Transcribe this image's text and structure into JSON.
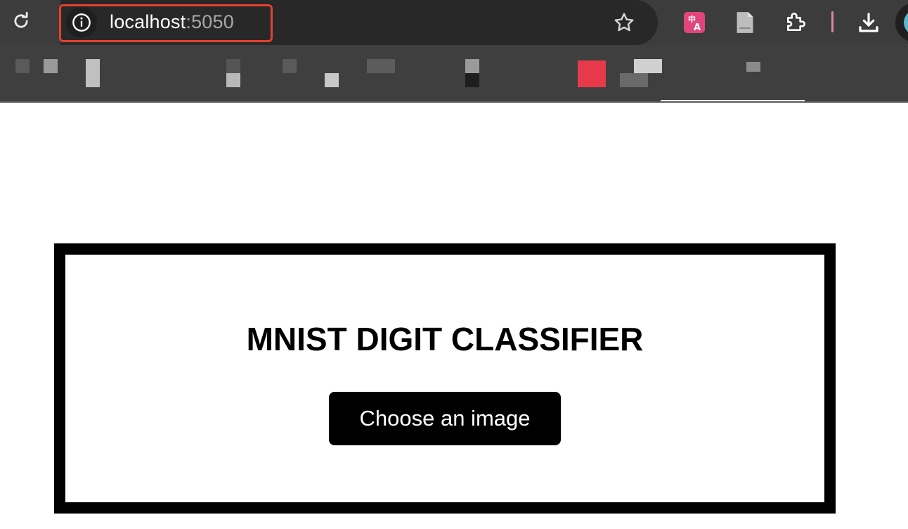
{
  "browser": {
    "url_host": "localhost",
    "url_port": ":5050",
    "icons": [
      "reload-icon",
      "info-icon",
      "star-icon",
      "translate-icon",
      "document-icon",
      "extensions-icon",
      "download-icon",
      "profile-avatar"
    ],
    "colors": {
      "toolbar": "#3c3c3c",
      "omnibox": "#282828",
      "highlight": "#e5402f",
      "translate": "#e0457b"
    }
  },
  "page": {
    "title": "MNIST DIGIT CLASSIFIER",
    "choose_button_label": "Choose an image"
  }
}
